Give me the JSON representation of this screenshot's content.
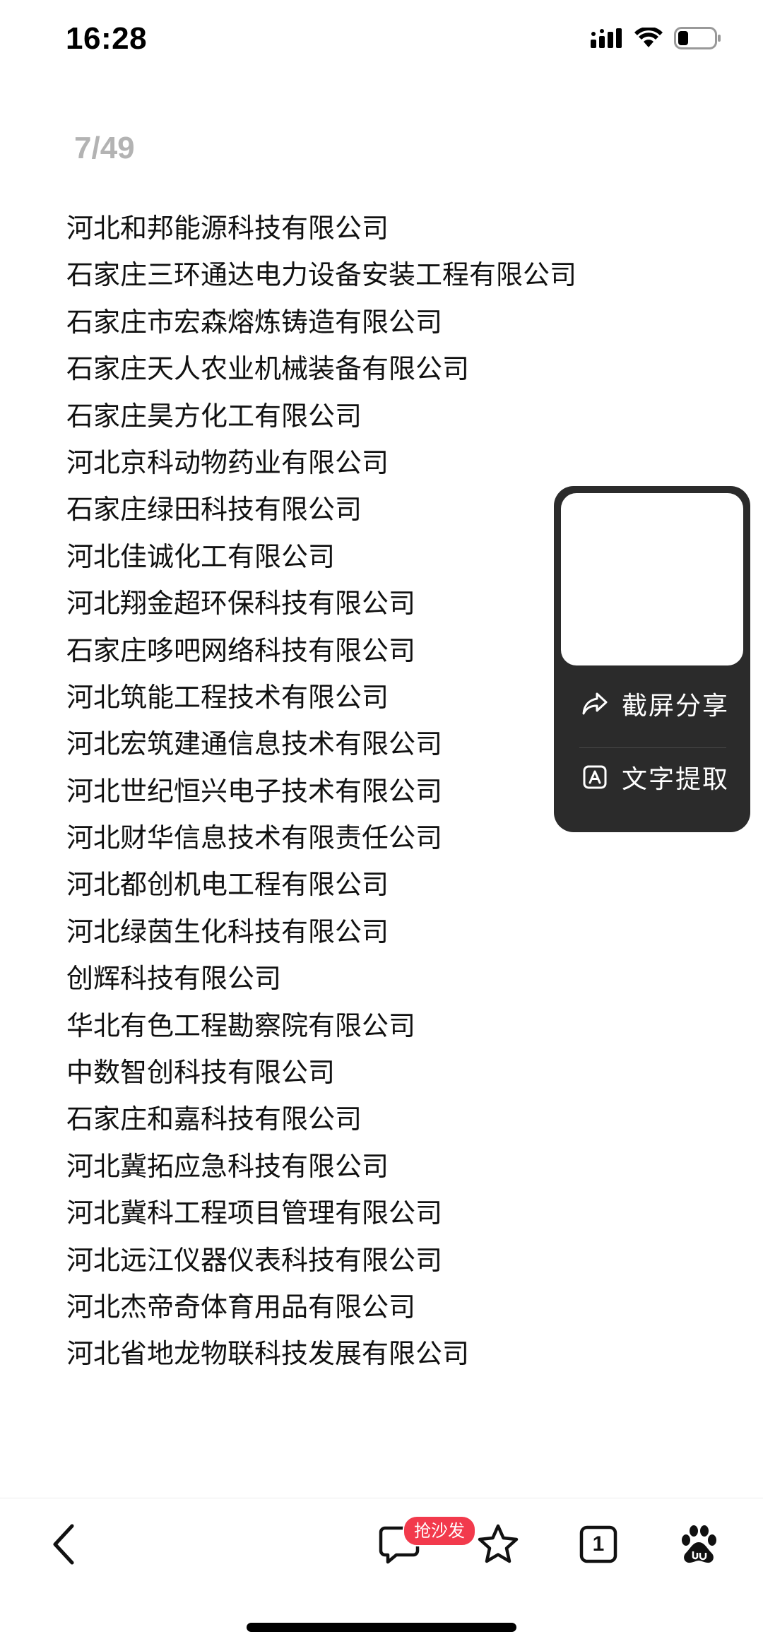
{
  "status_bar": {
    "time": "16:28",
    "icons": [
      "signal-icon",
      "wifi-icon",
      "battery-icon"
    ]
  },
  "page_counter": "7/49",
  "companies": [
    "河北和邦能源科技有限公司",
    "石家庄三环通达电力设备安装工程有限公司",
    "石家庄市宏森熔炼铸造有限公司",
    "石家庄天人农业机械装备有限公司",
    "石家庄昊方化工有限公司",
    "河北京科动物药业有限公司",
    "石家庄绿田科技有限公司",
    "河北佳诚化工有限公司",
    "河北翔金超环保科技有限公司",
    "石家庄哆吧网络科技有限公司",
    "河北筑能工程技术有限公司",
    "河北宏筑建通信息技术有限公司",
    "河北世纪恒兴电子技术有限公司",
    "河北财华信息技术有限责任公司",
    "河北都创机电工程有限公司",
    "河北绿茵生化科技有限公司",
    "创辉科技有限公司",
    "华北有色工程勘察院有限公司",
    "中数智创科技有限公司",
    "石家庄和嘉科技有限公司",
    "河北冀拓应急科技有限公司",
    "河北冀科工程项目管理有限公司",
    "河北远江仪器仪表科技有限公司",
    "河北杰帝奇体育用品有限公司",
    "河北省地龙物联科技发展有限公司"
  ],
  "screenshot_panel": {
    "share_label": "截屏分享",
    "extract_label": "文字提取",
    "share_icon": "share-arrow-icon",
    "extract_icon": "text-extract-icon"
  },
  "toolbar": {
    "comment_badge": "抢沙发",
    "tab_count": "1",
    "icons": [
      "back-chevron-icon",
      "comment-icon",
      "star-icon",
      "tabs-icon",
      "baidu-paw-icon"
    ]
  },
  "colors": {
    "panel_bg": "#2b2b2b",
    "badge_bg": "#f23a4c",
    "counter_text": "#b3b3b3"
  }
}
